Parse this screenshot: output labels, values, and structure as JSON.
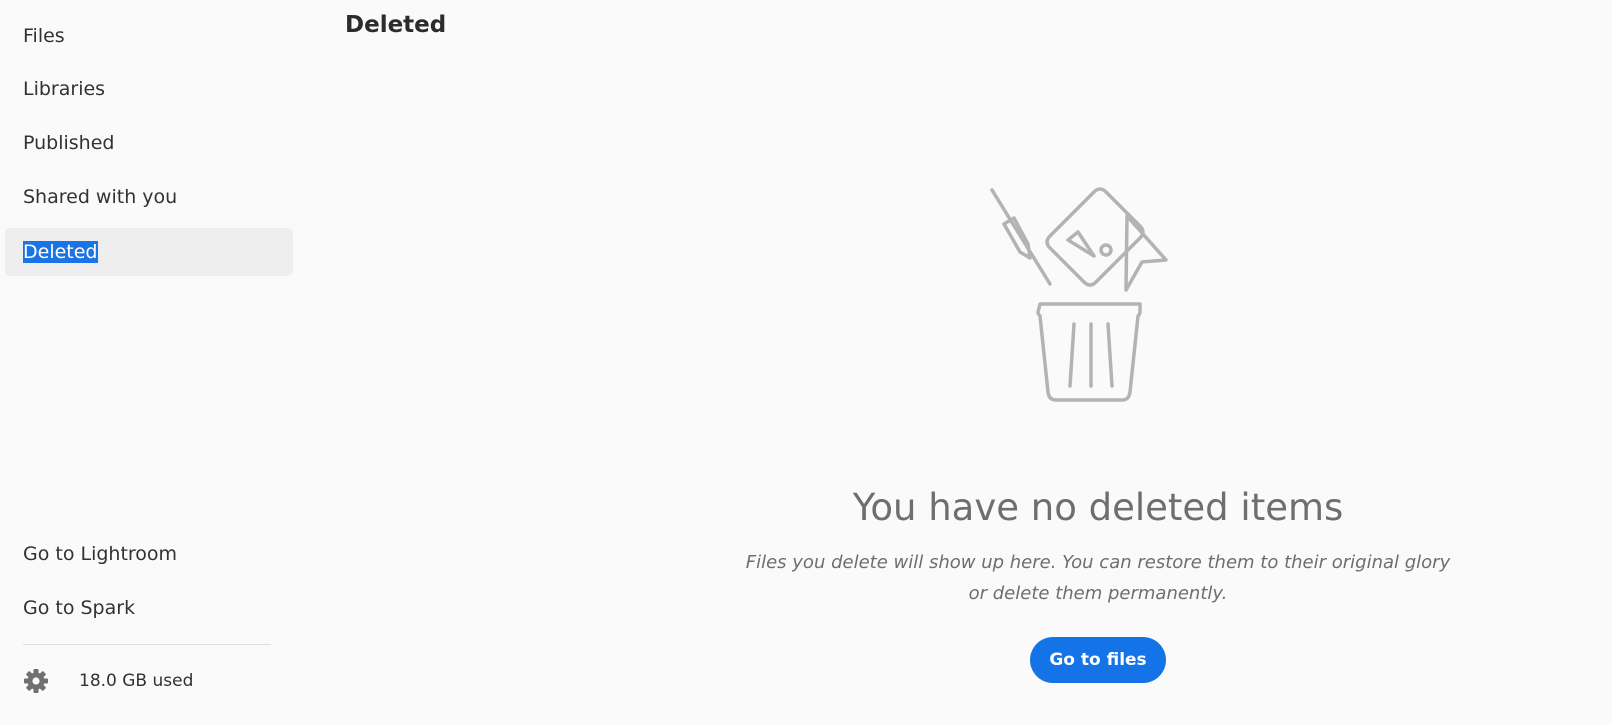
{
  "sidebar": {
    "items": [
      {
        "label": "Files",
        "active": false
      },
      {
        "label": "Libraries",
        "active": false
      },
      {
        "label": "Published",
        "active": false
      },
      {
        "label": "Shared with you",
        "active": false
      },
      {
        "label": "Deleted",
        "active": true
      }
    ],
    "links": [
      {
        "label": "Go to Lightroom"
      },
      {
        "label": "Go to Spark"
      }
    ],
    "storage": {
      "icon": "gear-icon",
      "text": "18.0 GB used"
    }
  },
  "main": {
    "title": "Deleted",
    "empty_state": {
      "illustration": "trash-icon",
      "heading": "You have no deleted items",
      "description": "Files you delete will show up here. You can restore them to their original glory or delete them permanently.",
      "button_label": "Go to files"
    }
  },
  "colors": {
    "accent": "#1473e6",
    "selection": "#1b73e8",
    "active_bg": "#eeeeee",
    "background": "#fafafa"
  }
}
